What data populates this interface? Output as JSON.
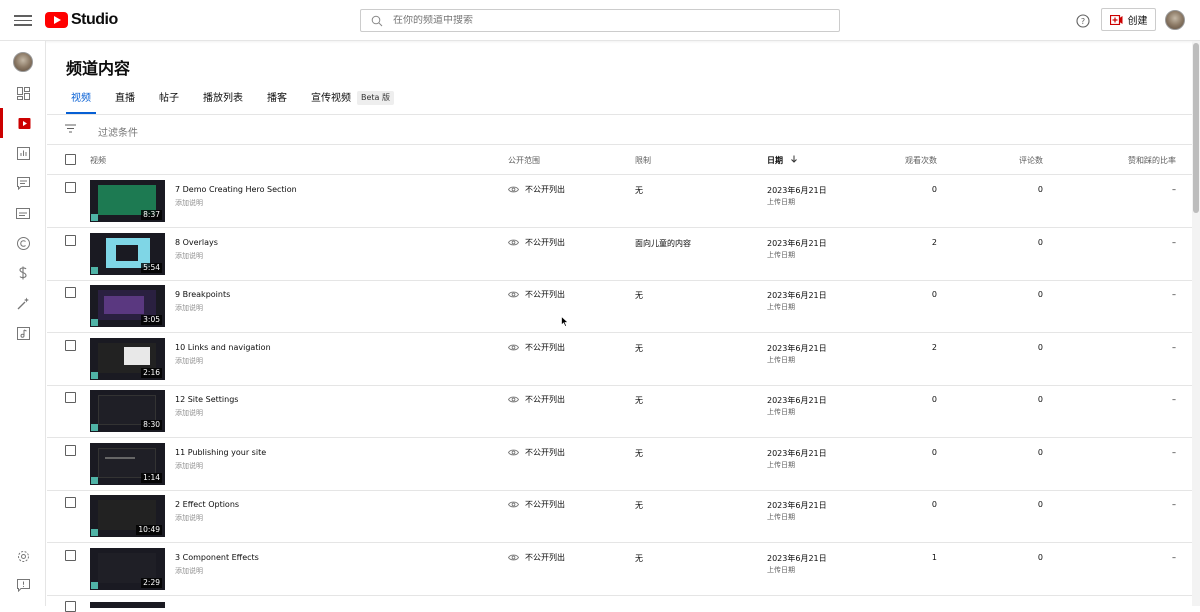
{
  "app": {
    "brand": "Studio"
  },
  "search": {
    "placeholder": "在你的频道中搜索"
  },
  "header": {
    "create_label": "创建"
  },
  "page": {
    "title": "频道内容"
  },
  "tabs": [
    {
      "label": "视频"
    },
    {
      "label": "直播"
    },
    {
      "label": "帖子"
    },
    {
      "label": "播放列表"
    },
    {
      "label": "播客"
    },
    {
      "label": "宣传视频",
      "badge": "Beta 版"
    }
  ],
  "filter": {
    "label": "过滤条件"
  },
  "columns": {
    "video": "视频",
    "visibility": "公开范围",
    "restrictions": "限制",
    "date": "日期",
    "views": "观看次数",
    "comments": "评论数",
    "likes_ratio": "赞和踩的比率"
  },
  "videos": [
    {
      "title": "7 Demo Creating Hero Section",
      "desc": "添加说明",
      "duration": "8:37",
      "visibility": "不公开列出",
      "restriction": "无",
      "date": "2023年6月21日",
      "date_note": "上传日期",
      "views": "0",
      "comments": "0",
      "ratio": "–"
    },
    {
      "title": "8 Overlays",
      "desc": "添加说明",
      "duration": "5:54",
      "visibility": "不公开列出",
      "restriction": "面向儿童的内容",
      "date": "2023年6月21日",
      "date_note": "上传日期",
      "views": "2",
      "comments": "0",
      "ratio": "–"
    },
    {
      "title": "9 Breakpoints",
      "desc": "添加说明",
      "duration": "3:05",
      "visibility": "不公开列出",
      "restriction": "无",
      "date": "2023年6月21日",
      "date_note": "上传日期",
      "views": "0",
      "comments": "0",
      "ratio": "–"
    },
    {
      "title": "10 Links and navigation",
      "desc": "添加说明",
      "duration": "2:16",
      "visibility": "不公开列出",
      "restriction": "无",
      "date": "2023年6月21日",
      "date_note": "上传日期",
      "views": "2",
      "comments": "0",
      "ratio": "–"
    },
    {
      "title": "12 Site Settings",
      "desc": "添加说明",
      "duration": "8:30",
      "visibility": "不公开列出",
      "restriction": "无",
      "date": "2023年6月21日",
      "date_note": "上传日期",
      "views": "0",
      "comments": "0",
      "ratio": "–"
    },
    {
      "title": "11 Publishing your site",
      "desc": "添加说明",
      "duration": "1:14",
      "visibility": "不公开列出",
      "restriction": "无",
      "date": "2023年6月21日",
      "date_note": "上传日期",
      "views": "0",
      "comments": "0",
      "ratio": "–"
    },
    {
      "title": "2 Effect Options",
      "desc": "添加说明",
      "duration": "10:49",
      "visibility": "不公开列出",
      "restriction": "无",
      "date": "2023年6月21日",
      "date_note": "上传日期",
      "views": "0",
      "comments": "0",
      "ratio": "–"
    },
    {
      "title": "3 Component Effects",
      "desc": "添加说明",
      "duration": "2:29",
      "visibility": "不公开列出",
      "restriction": "无",
      "date": "2023年6月21日",
      "date_note": "上传日期",
      "views": "1",
      "comments": "0",
      "ratio": "–"
    }
  ],
  "colors": {
    "accent": "#065fd4",
    "brand_red": "#ff0000",
    "active_nav": "#cc0000"
  }
}
